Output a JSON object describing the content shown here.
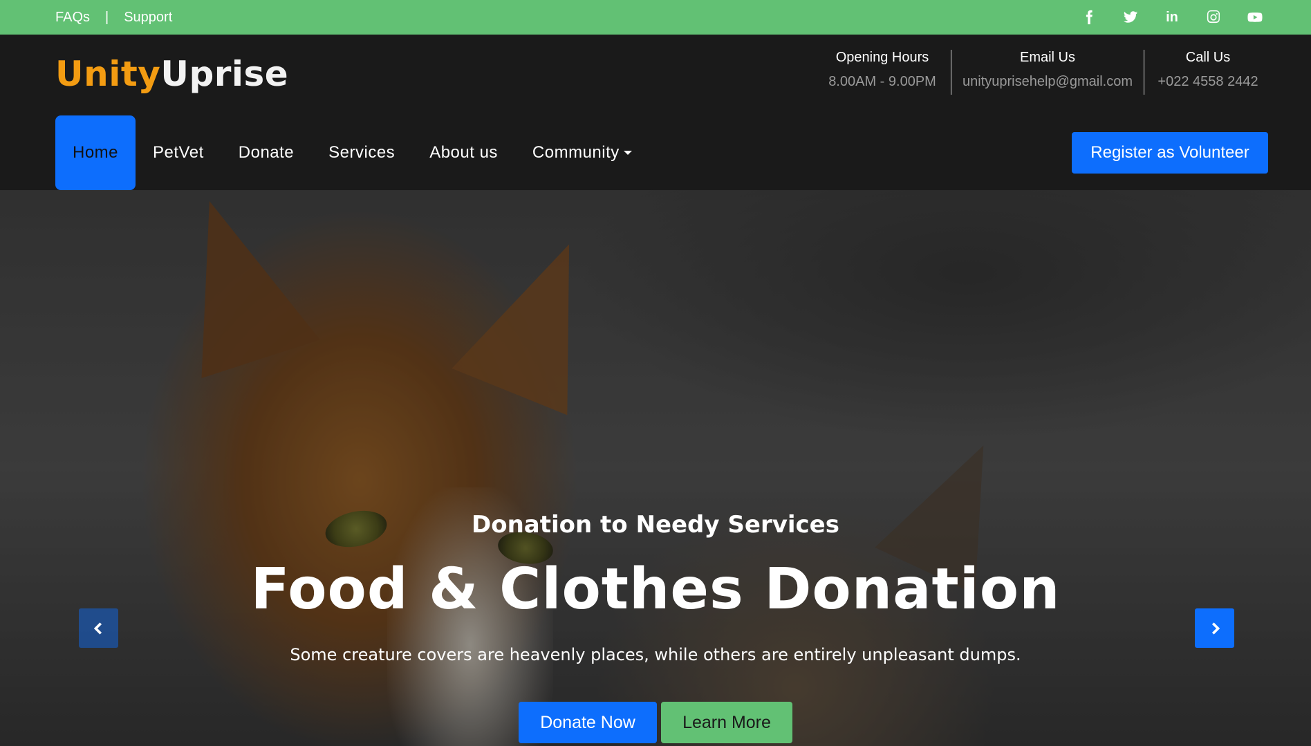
{
  "topbar": {
    "links": [
      "FAQs",
      "|",
      "Support"
    ],
    "social": [
      "facebook-icon",
      "twitter-icon",
      "linkedin-icon",
      "instagram-icon",
      "youtube-icon"
    ],
    "linkedin_text": "in"
  },
  "brand": {
    "part1": "Unity",
    "part2": "Uprise"
  },
  "contact": {
    "hours": {
      "label": "Opening Hours",
      "value": "8.00AM - 9.00PM"
    },
    "email": {
      "label": "Email Us",
      "value": "unityuprisehelp@gmail.com"
    },
    "call": {
      "label": "Call Us",
      "value": "+022 4558 2442"
    }
  },
  "nav": {
    "items": [
      "Home",
      "PetVet",
      "Donate",
      "Services",
      "About us",
      "Community"
    ],
    "active": "Home",
    "volunteer_label": "Register as Volunteer"
  },
  "hero": {
    "subtitle": "Donation to Needy Services",
    "title": "Food & Clothes Donation",
    "description": "Some creature covers are heavenly places, while others are entirely unpleasant dumps.",
    "donate_label": "Donate Now",
    "learn_label": "Learn More"
  },
  "colors": {
    "topbar": "#62c174",
    "header": "#1a1a1a",
    "primary": "#0d6efd",
    "success": "#62c174",
    "brand_orange": "#f39c12"
  }
}
